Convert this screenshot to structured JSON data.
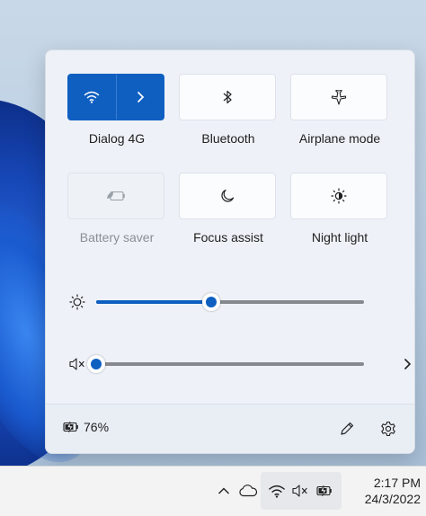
{
  "quick_settings": {
    "tiles": [
      {
        "label": "Dialog 4G",
        "icon": "wifi-icon",
        "state": "active"
      },
      {
        "label": "Bluetooth",
        "icon": "bluetooth-icon",
        "state": "off"
      },
      {
        "label": "Airplane mode",
        "icon": "airplane-icon",
        "state": "off"
      },
      {
        "label": "Battery saver",
        "icon": "battery-saver-icon",
        "state": "disabled"
      },
      {
        "label": "Focus assist",
        "icon": "moon-icon",
        "state": "off"
      },
      {
        "label": "Night light",
        "icon": "brightness-icon",
        "state": "off"
      }
    ],
    "brightness": {
      "icon": "brightness-icon",
      "value_percent": 43
    },
    "volume": {
      "icon": "speaker-muted-icon",
      "value_percent": 0
    },
    "footer": {
      "battery_percent": "76%",
      "battery_icon": "battery-charging-icon",
      "edit_icon": "pencil-icon",
      "settings_icon": "gear-icon"
    }
  },
  "taskbar": {
    "tray": [
      "chevron-up-icon",
      "cloud-icon",
      "wifi-icon",
      "speaker-muted-icon",
      "battery-charging-icon"
    ],
    "time": "2:17 PM",
    "date": "24/3/2022"
  },
  "colors": {
    "accent": "#0f5fc1",
    "panel_bg": "#eef2f8",
    "track": "#868a8f"
  }
}
